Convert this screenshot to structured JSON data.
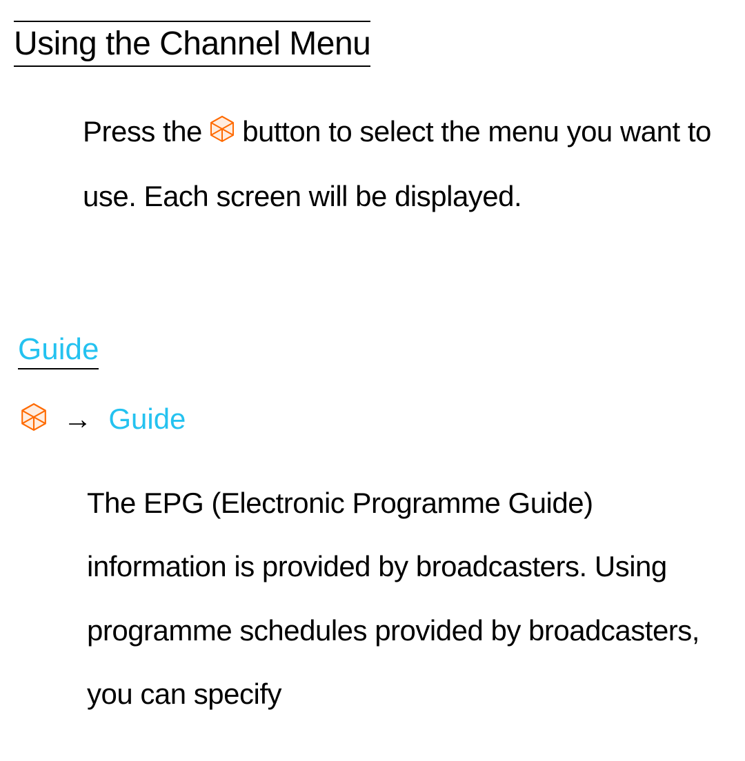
{
  "section": {
    "title": "Using the Channel Menu",
    "intro_before": "Press the ",
    "intro_after": " button to select the menu you want to use. Each screen will be displayed."
  },
  "subsection": {
    "title": "Guide",
    "nav_arrow": "→",
    "nav_target": "Guide",
    "body": "The EPG (Electronic Programme Guide) information is provided by broadcasters. Using programme schedules provided by broadcasters, you can specify"
  },
  "icon": {
    "color": "#ff6a00"
  }
}
